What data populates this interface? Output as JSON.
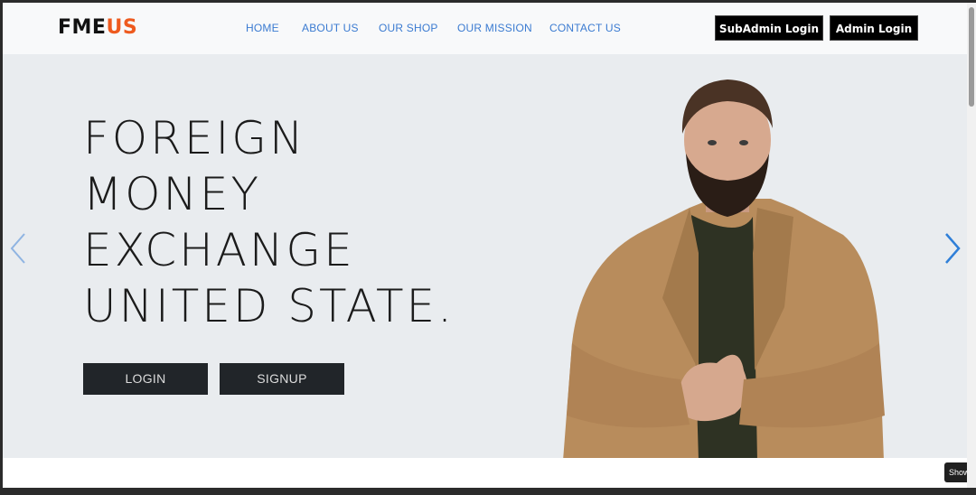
{
  "brand": {
    "part1": "FME",
    "part2": "US"
  },
  "nav": {
    "items": [
      {
        "label": "HOME"
      },
      {
        "label": "ABOUT US"
      },
      {
        "label": "OUR SHOP"
      },
      {
        "label": "OUR MISSION"
      },
      {
        "label": "CONTACT US"
      }
    ],
    "subadmin_login": "SubAdmin Login",
    "admin_login": "Admin Login"
  },
  "hero": {
    "lines": [
      "FOREIGN",
      "MONEY",
      "EXCHANGE",
      "UNITED STATE."
    ],
    "login_label": "LOGIN",
    "signup_label": "SIGNUP"
  },
  "tooltip": {
    "text": "Show d"
  },
  "colors": {
    "brand_accent": "#ee5a1e",
    "nav_link": "#3b7bd1",
    "hero_bg": "#e9ecef",
    "button_dark": "#212529",
    "arrow": "#2f7fd8"
  }
}
